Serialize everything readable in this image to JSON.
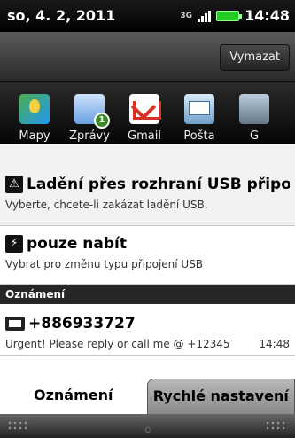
{
  "status": {
    "date": "so, 4. 2, 2011",
    "network": "3G",
    "time": "14:48"
  },
  "toolbar": {
    "clear_label": "Vymazat"
  },
  "apps": [
    {
      "label": "Mapy",
      "icon": "maps-icon"
    },
    {
      "label": "Zprávy",
      "icon": "messages-icon",
      "badge": "1"
    },
    {
      "label": "Gmail",
      "icon": "gmail-icon"
    },
    {
      "label": "Pošta",
      "icon": "mail-icon"
    },
    {
      "label": "G",
      "icon": "app-icon"
    }
  ],
  "ongoing": [
    {
      "title": "Ladění přes rozhraní USB připoje",
      "subtitle": "Vyberte, chcete-li zakázat ladění USB.",
      "icon": "warning-icon"
    },
    {
      "title": "pouze nabít",
      "subtitle": "Vybrat pro změnu typu připojení USB",
      "icon": "usb-icon"
    }
  ],
  "section_title": "Oznámení",
  "notifications": [
    {
      "sender": "+886933727",
      "message": "Urgent! Please reply or call me @ +12345",
      "time": "14:48",
      "icon": "message-icon"
    }
  ],
  "tabs": {
    "notifications_label": "Oznámení",
    "quick_settings_label": "Rychlé nastavení"
  }
}
